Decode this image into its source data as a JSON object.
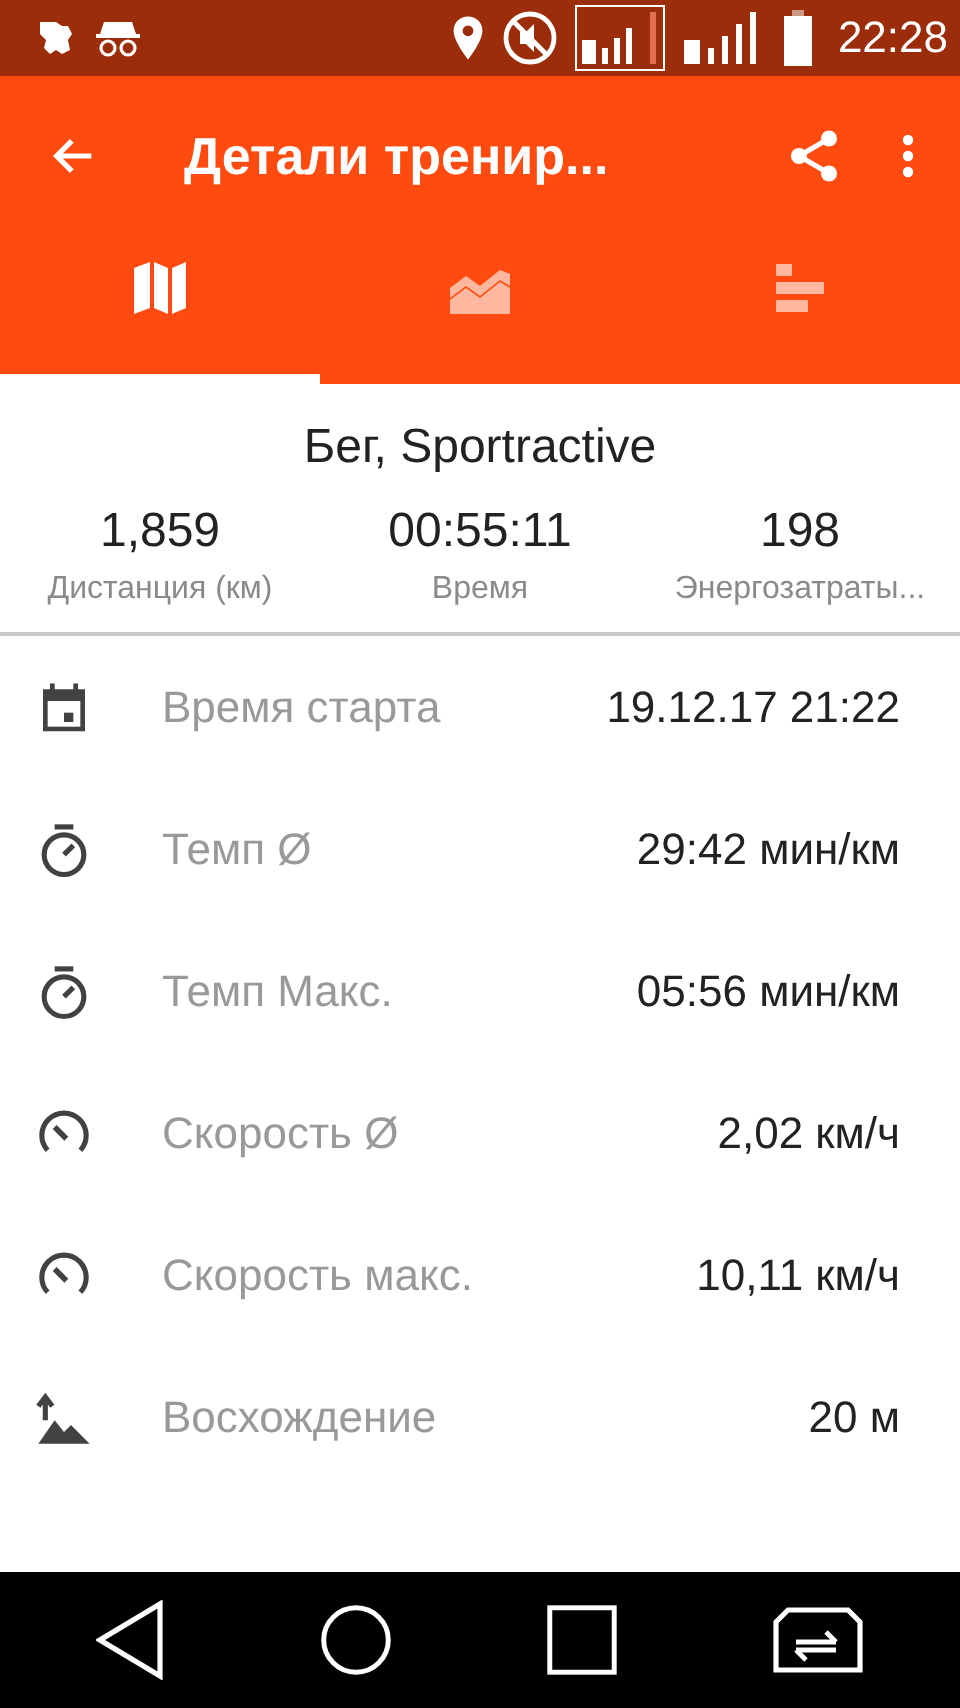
{
  "status_bar": {
    "time": "22:28"
  },
  "toolbar": {
    "title": "Детали тренир..."
  },
  "tabs": [
    {
      "kind": "map",
      "selected": true
    },
    {
      "kind": "chart",
      "selected": false
    },
    {
      "kind": "bars",
      "selected": false
    }
  ],
  "summary": {
    "title": "Бег, Sportractive",
    "stats": [
      {
        "value": "1,859",
        "label": "Дистанция (км)"
      },
      {
        "value": "00:55:11",
        "label": "Время"
      },
      {
        "value": "198",
        "label": "Энергозатраты..."
      }
    ]
  },
  "details": [
    {
      "kind": "calendar",
      "label": "Время старта",
      "value": "19.12.17 21:22"
    },
    {
      "kind": "stopwatch",
      "label": "Темп Ø",
      "value": "29:42 мин/км"
    },
    {
      "kind": "stopwatch",
      "label": "Темп Макс.",
      "value": "05:56 мин/км"
    },
    {
      "kind": "speedometer",
      "label": "Скорость Ø",
      "value": "2,02 км/ч"
    },
    {
      "kind": "speedometer",
      "label": "Скорость макс.",
      "value": "10,11 км/ч"
    },
    {
      "kind": "ascent",
      "label": "Восхождение",
      "value": "20 м"
    }
  ]
}
